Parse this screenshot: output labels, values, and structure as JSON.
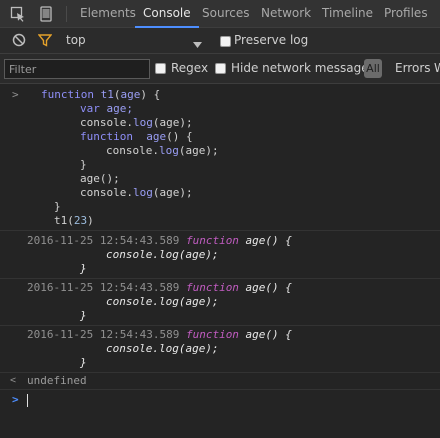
{
  "tabs": [
    {
      "label": "Elements",
      "active": false
    },
    {
      "label": "Console",
      "active": true
    },
    {
      "label": "Sources",
      "active": false
    },
    {
      "label": "Network",
      "active": false
    },
    {
      "label": "Timeline",
      "active": false
    },
    {
      "label": "Profiles",
      "active": false
    }
  ],
  "context": {
    "value": "top"
  },
  "preserve_log": {
    "label": "Preserve log",
    "checked": false
  },
  "filter": {
    "placeholder": "Filter",
    "regex_label": "Regex",
    "hide_network_label": "Hide network messages",
    "all_label": "All",
    "errors_label": "Errors",
    "overflow_label": "W"
  },
  "input_prompt": ">",
  "input_code": {
    "l1_kw": "function",
    "l1_name": " t1",
    "l1_open": "(",
    "l1_param": "age",
    "l1_close": ") {",
    "l2_kw": "var",
    "l2_rest": " age;",
    "l3_a": "console.",
    "l3_b": "log",
    "l3_c": "(age);",
    "l4_kw": "function",
    "l4_name": "  age",
    "l4_rest": "() {",
    "l5_a": "console.",
    "l5_b": "log",
    "l5_c": "(age);",
    "l6": "}",
    "l7": "age();",
    "l8_a": "console.",
    "l8_b": "log",
    "l8_c": "(age);",
    "l9": "}",
    "l10_a": "t1(",
    "l10_num": "23",
    "l10_b": ")"
  },
  "log_messages": [
    {
      "timestamp": "2016-11-25 12:54:43.589",
      "kw": "function",
      "name": " age() {",
      "body": "console.log(age);",
      "close": "}"
    },
    {
      "timestamp": "2016-11-25 12:54:43.589",
      "kw": "function",
      "name": " age() {",
      "body": "console.log(age);",
      "close": "}"
    },
    {
      "timestamp": "2016-11-25 12:54:43.589",
      "kw": "function",
      "name": " age() {",
      "body": "console.log(age);",
      "close": "}"
    }
  ],
  "result": {
    "arrow": "<",
    "value": "undefined"
  },
  "prompt_symbol": ">",
  "colors": {
    "accent": "#4d8eff",
    "keyword": "#8e8ef7",
    "function_italic": "#c05cc0"
  }
}
